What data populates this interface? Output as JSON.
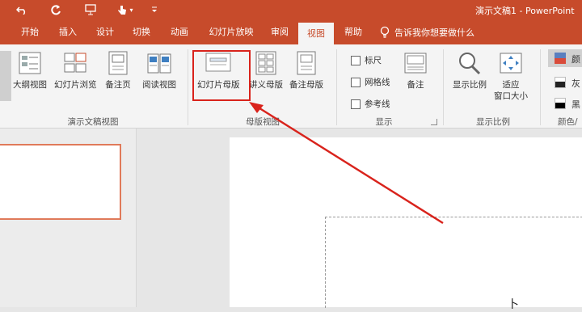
{
  "qat": {
    "undo_icon": "undo-icon",
    "redo_icon": "redo-icon",
    "present_icon": "start-from-beginning-icon",
    "touch_icon": "touch-mode-icon",
    "customize_icon": "customize-qat-icon"
  },
  "window": {
    "title": "演示文稿1 - PowerPoint"
  },
  "tabs": [
    "开始",
    "插入",
    "设计",
    "切换",
    "动画",
    "幻灯片放映",
    "审阅",
    "视图",
    "帮助"
  ],
  "tellme": "告诉我你想要做什么",
  "ribbon": {
    "presentation_views": {
      "label": "演示文稿视图",
      "outline": "大纲视图",
      "slide_sorter": "幻灯片浏览",
      "notes_page": "备注页",
      "reading_view": "阅读视图"
    },
    "master_views": {
      "label": "母版视图",
      "slide_master": "幻灯片母版",
      "handout_master": "讲义母版",
      "notes_master": "备注母版"
    },
    "show": {
      "label": "显示",
      "ruler": "标尺",
      "gridlines": "网格线",
      "guides": "参考线",
      "notes": "备注"
    },
    "zoom": {
      "label": "显示比例",
      "zoom": "显示比例",
      "fit_window": [
        "适应",
        "窗口大小"
      ]
    },
    "color": {
      "label": "颜色/",
      "color": "颜",
      "grayscale": "灰",
      "black_white": "黑"
    }
  },
  "slide_text": "卜"
}
